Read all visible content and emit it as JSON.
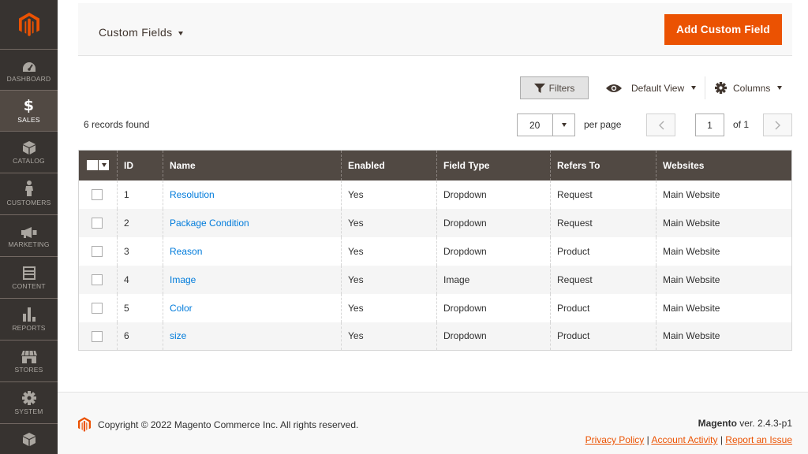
{
  "sidebar": {
    "items": [
      {
        "label": "DASHBOARD",
        "icon": "dashboard-gauge-icon"
      },
      {
        "label": "SALES",
        "icon": "dollar-icon",
        "active": true
      },
      {
        "label": "CATALOG",
        "icon": "cube-icon"
      },
      {
        "label": "CUSTOMERS",
        "icon": "person-icon"
      },
      {
        "label": "MARKETING",
        "icon": "megaphone-icon"
      },
      {
        "label": "CONTENT",
        "icon": "content-layout-icon"
      },
      {
        "label": "REPORTS",
        "icon": "bar-chart-icon"
      },
      {
        "label": "STORES",
        "icon": "storefront-icon"
      },
      {
        "label": "SYSTEM",
        "icon": "gear-icon"
      }
    ]
  },
  "header": {
    "title": "Custom Fields",
    "add_button": "Add Custom Field"
  },
  "toolbar": {
    "filters_label": "Filters",
    "view_label": "Default View",
    "columns_label": "Columns",
    "records_found": "6 records found",
    "per_page_value": "20",
    "per_page_label": "per page",
    "current_page": "1",
    "total_pages_label": "of 1"
  },
  "grid": {
    "columns": [
      "ID",
      "Name",
      "Enabled",
      "Field Type",
      "Refers To",
      "Websites"
    ],
    "rows": [
      {
        "id": "1",
        "name": "Resolution",
        "enabled": "Yes",
        "field_type": "Dropdown",
        "refers_to": "Request",
        "websites": "Main Website"
      },
      {
        "id": "2",
        "name": "Package Condition",
        "enabled": "Yes",
        "field_type": "Dropdown",
        "refers_to": "Request",
        "websites": "Main Website"
      },
      {
        "id": "3",
        "name": "Reason",
        "enabled": "Yes",
        "field_type": "Dropdown",
        "refers_to": "Product",
        "websites": "Main Website"
      },
      {
        "id": "4",
        "name": "Image",
        "enabled": "Yes",
        "field_type": "Image",
        "refers_to": "Request",
        "websites": "Main Website"
      },
      {
        "id": "5",
        "name": "Color",
        "enabled": "Yes",
        "field_type": "Dropdown",
        "refers_to": "Product",
        "websites": "Main Website"
      },
      {
        "id": "6",
        "name": "size",
        "enabled": "Yes",
        "field_type": "Dropdown",
        "refers_to": "Product",
        "websites": "Main Website"
      }
    ]
  },
  "footer": {
    "copyright": "Copyright © 2022 Magento Commerce Inc. All rights reserved.",
    "brand": "Magento",
    "version": " ver. 2.4.3-p1",
    "links": [
      "Privacy Policy",
      "Account Activity",
      "Report an Issue"
    ],
    "link_separator": " | "
  },
  "colors": {
    "accent": "#eb5202",
    "sidebar_bg": "#373330",
    "grid_header_bg": "#514943",
    "link": "#007bdb"
  }
}
